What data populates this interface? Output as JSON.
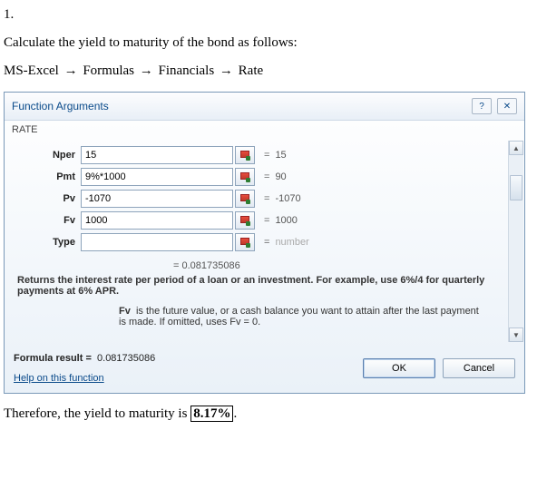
{
  "question": {
    "number": "1.",
    "instruction": "Calculate the yield to maturity of the bond as follows:",
    "breadcrumb": [
      "MS-Excel",
      "Formulas",
      "Financials",
      "Rate"
    ]
  },
  "dialog": {
    "title": "Function Arguments",
    "fn": "RATE",
    "args": [
      {
        "label": "Nper",
        "value": "15",
        "result": "15"
      },
      {
        "label": "Pmt",
        "value": "9%*1000",
        "result": "90"
      },
      {
        "label": "Pv",
        "value": "-1070",
        "result": "-1070"
      },
      {
        "label": "Fv",
        "value": "1000",
        "result": "1000"
      },
      {
        "label": "Type",
        "value": "",
        "result": "number",
        "ghost": true
      }
    ],
    "overall_result": "=   0.081735086",
    "description": "Returns the interest rate per period of a loan or an investment. For example, use 6%/4 for quarterly payments at 6% APR.",
    "arg_help_label": "Fv",
    "arg_help_text": "is the future value, or a cash balance you want to attain after the last payment is made. If omitted, uses Fv = 0.",
    "formula_result_label": "Formula result =",
    "formula_result_value": "0.081735086",
    "help_link": "Help on this function",
    "ok": "OK",
    "cancel": "Cancel"
  },
  "conclusion": {
    "prefix": "Therefore, the yield to maturity is ",
    "value": "8.17%",
    "suffix": "."
  }
}
